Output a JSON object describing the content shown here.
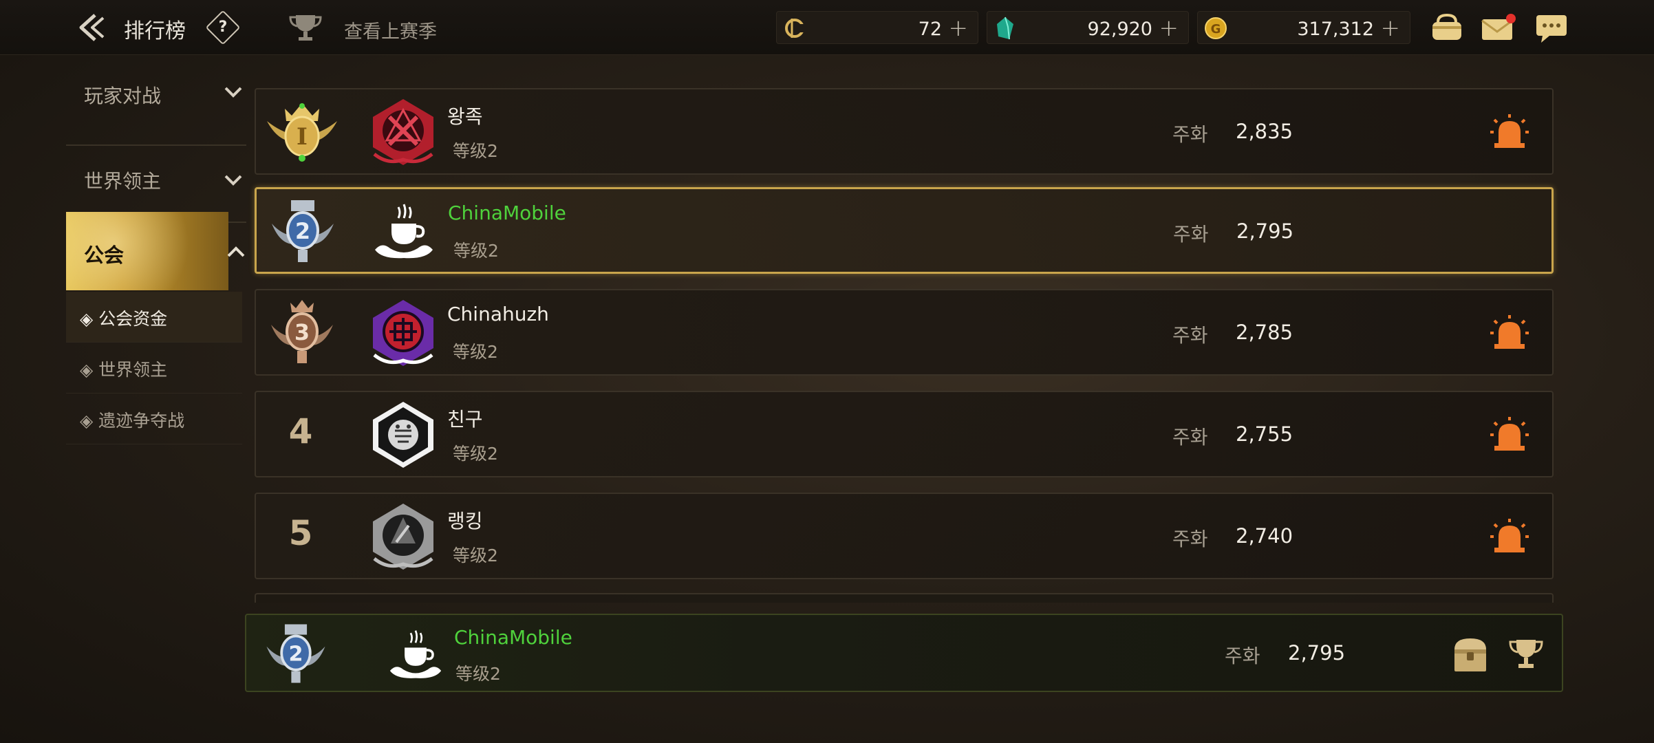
{
  "header": {
    "title": "排行榜",
    "help_symbol": "?",
    "prev_season": "查看上赛季",
    "currencies": [
      {
        "icon": "stamina-icon",
        "value": "72"
      },
      {
        "icon": "gem-icon",
        "value": "92,920"
      },
      {
        "icon": "gold-coin-icon",
        "value": "317,312"
      }
    ],
    "plus": "+"
  },
  "sidebar": {
    "categories": [
      {
        "label": "玩家对战",
        "expanded": false
      },
      {
        "label": "世界领主",
        "expanded": false
      },
      {
        "label": "公会",
        "expanded": true
      }
    ],
    "sub_items": [
      {
        "label": "◈ 公会资金",
        "selected": true
      },
      {
        "label": "◈ 世界领主",
        "selected": false
      },
      {
        "label": "◈ 遗迹争夺战",
        "selected": false
      }
    ]
  },
  "rankings": [
    {
      "rank": "1",
      "name": "왕족",
      "level": "等级2",
      "score_label": "주화",
      "score": "2,835",
      "highlight": false,
      "badge": "gold"
    },
    {
      "rank": "2",
      "name": "ChinaMobile",
      "level": "等级2",
      "score_label": "주화",
      "score": "2,795",
      "highlight": true,
      "badge": "silver"
    },
    {
      "rank": "3",
      "name": "Chinahuzh",
      "level": "等级2",
      "score_label": "주화",
      "score": "2,785",
      "highlight": false,
      "badge": "bronze"
    },
    {
      "rank": "4",
      "name": "친구",
      "level": "等级2",
      "score_label": "주화",
      "score": "2,755",
      "highlight": false,
      "badge": "none"
    },
    {
      "rank": "5",
      "name": "랭킹",
      "level": "等级2",
      "score_label": "주화",
      "score": "2,740",
      "highlight": false,
      "badge": "none"
    }
  ],
  "my_guild": {
    "rank": "2",
    "name": "ChinaMobile",
    "level": "等级2",
    "score_label": "주화",
    "score": "2,795"
  },
  "colors": {
    "accent_gold": "#c9a54c",
    "name_green": "#4fd23c",
    "alarm_orange": "#f07a2a"
  }
}
